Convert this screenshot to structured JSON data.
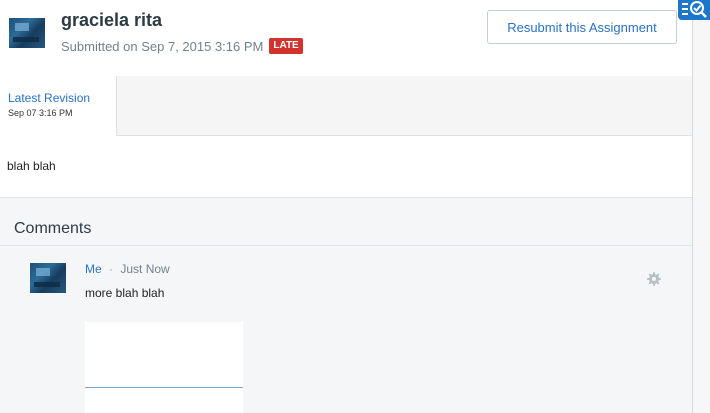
{
  "header": {
    "student_name": "graciela rita",
    "submitted_text": "Submitted on Sep 7, 2015 3:16 PM",
    "late_badge": "LATE",
    "resubmit_label": "Resubmit this Assignment"
  },
  "revision": {
    "tab_label": "Latest Revision",
    "tab_date": "Sep 07 3:16 PM"
  },
  "submission": {
    "body_text": "blah blah"
  },
  "comments": {
    "heading": "Comments",
    "items": [
      {
        "author": "Me",
        "separator": "·",
        "time": "Just Now",
        "text": "more blah blah"
      }
    ]
  },
  "icons": {
    "gear": "gear-icon",
    "corner_tool": "checklist-search-icon"
  },
  "colors": {
    "link_blue": "#2a71c4",
    "late_red": "#d0342c",
    "corner_tool_blue": "#1d77c9"
  }
}
